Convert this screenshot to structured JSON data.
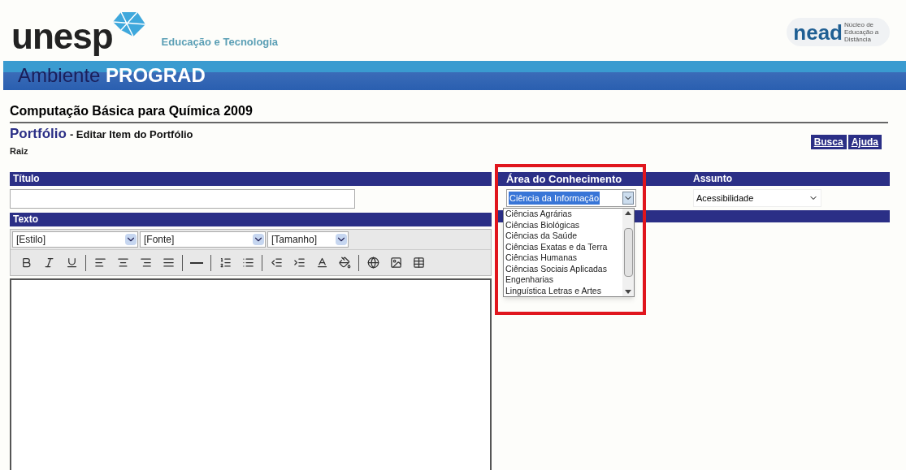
{
  "header": {
    "logo": "unesp",
    "tagline": "Educação e Tecnologia",
    "partner_logo": "nead",
    "partner_caption": "Núcleo de Educação a Distância"
  },
  "banner": {
    "prefix": "Ambiente",
    "name": "PROGRAD"
  },
  "course_title": "Computação Básica para Química 2009",
  "page": {
    "section": "Portfólio",
    "action": "- Editar Item do Portfólio",
    "breadcrumb": "Raiz"
  },
  "top_buttons": [
    "Busca",
    "Ajuda"
  ],
  "form": {
    "title_label": "Título",
    "text_label": "Texto",
    "editor_selects": [
      "[Estilo]",
      "[Fonte]",
      "[Tamanho]"
    ],
    "toolbar": [
      {
        "kind": "bold"
      },
      {
        "kind": "italic"
      },
      {
        "kind": "underline"
      },
      {
        "kind": "sep"
      },
      {
        "kind": "align-left"
      },
      {
        "kind": "align-center"
      },
      {
        "kind": "align-right"
      },
      {
        "kind": "align-justify"
      },
      {
        "kind": "sep"
      },
      {
        "kind": "rule"
      },
      {
        "kind": "sep"
      },
      {
        "kind": "ordered-list"
      },
      {
        "kind": "bullet-list"
      },
      {
        "kind": "sep"
      },
      {
        "kind": "outdent"
      },
      {
        "kind": "indent"
      },
      {
        "kind": "text-color"
      },
      {
        "kind": "fill-color"
      },
      {
        "kind": "sep"
      },
      {
        "kind": "link"
      },
      {
        "kind": "image"
      },
      {
        "kind": "table"
      }
    ]
  },
  "area": {
    "label": "Área do Conhecimento",
    "value": "Ciência da Informação",
    "highlighted": true,
    "options": [
      {
        "label": "Ciências Agrárias",
        "selected": false
      },
      {
        "label": "Ciências Biológicas",
        "selected": false
      },
      {
        "label": "Ciências da Saúde",
        "selected": false
      },
      {
        "label": "Ciências Exatas e da Terra",
        "selected": false
      },
      {
        "label": "Ciências Humanas",
        "selected": false
      },
      {
        "label": "Ciências Sociais Aplicadas",
        "selected": false
      },
      {
        "label": "Engenharias",
        "selected": false
      },
      {
        "label": "Linguística Letras e Artes",
        "selected": false
      }
    ]
  },
  "subject": {
    "label": "Assunto",
    "value": "Acessibilidade"
  }
}
